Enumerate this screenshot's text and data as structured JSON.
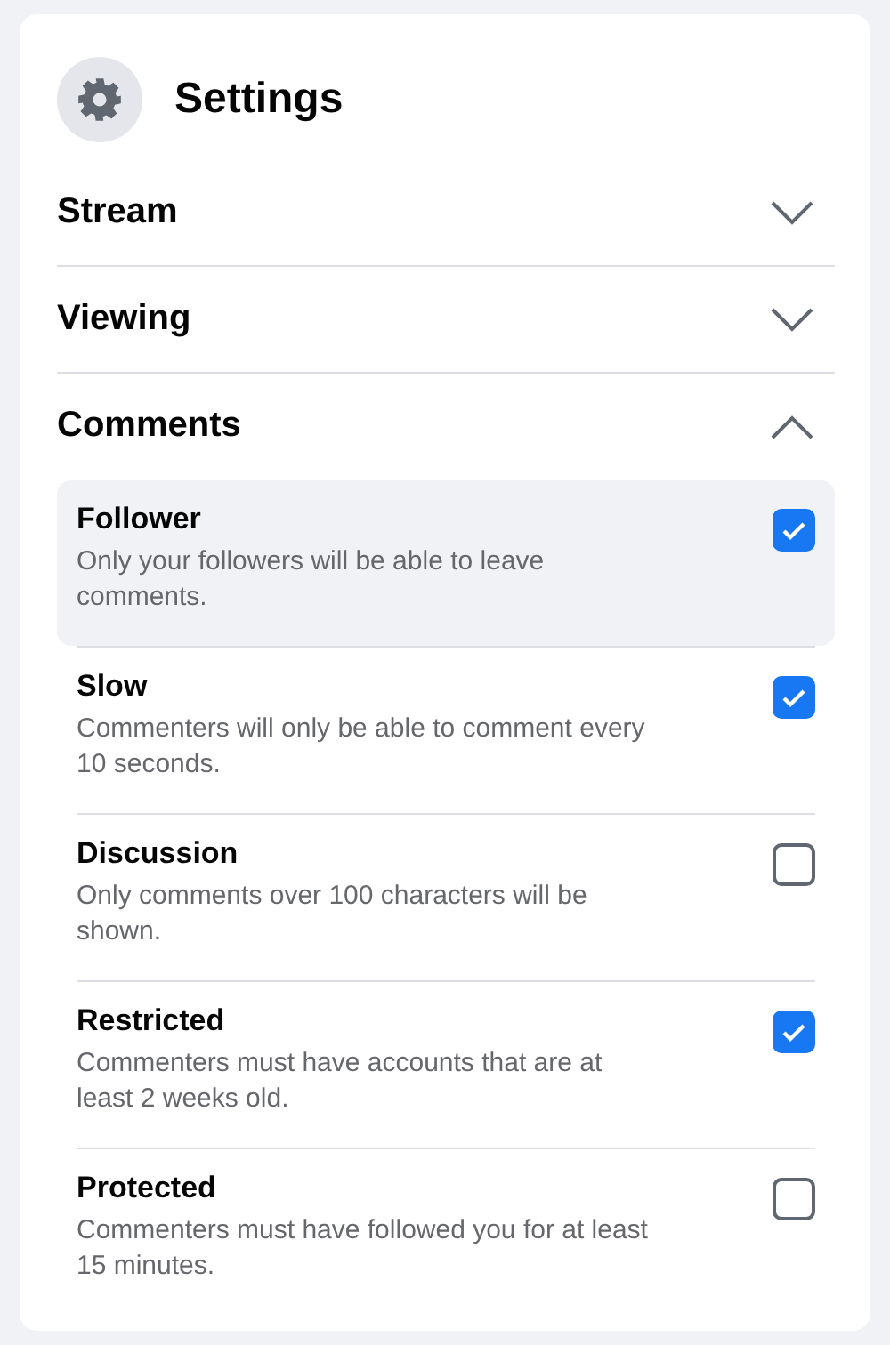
{
  "header": {
    "title": "Settings"
  },
  "sections": [
    {
      "label": "Stream",
      "expanded": false
    },
    {
      "label": "Viewing",
      "expanded": false
    },
    {
      "label": "Comments",
      "expanded": true,
      "options": [
        {
          "title": "Follower",
          "description": "Only your followers will be able to leave comments.",
          "checked": true,
          "highlighted": true
        },
        {
          "title": "Slow",
          "description": "Commenters will only be able to comment every 10 seconds.",
          "checked": true,
          "highlighted": false
        },
        {
          "title": "Discussion",
          "description": "Only comments over 100 characters will be shown.",
          "checked": false,
          "highlighted": false
        },
        {
          "title": "Restricted",
          "description": "Commenters must have accounts that are at least 2 weeks old.",
          "checked": true,
          "highlighted": false
        },
        {
          "title": "Protected",
          "description": "Commenters must have followed you for at least 15 minutes.",
          "checked": false,
          "highlighted": false
        }
      ]
    }
  ]
}
